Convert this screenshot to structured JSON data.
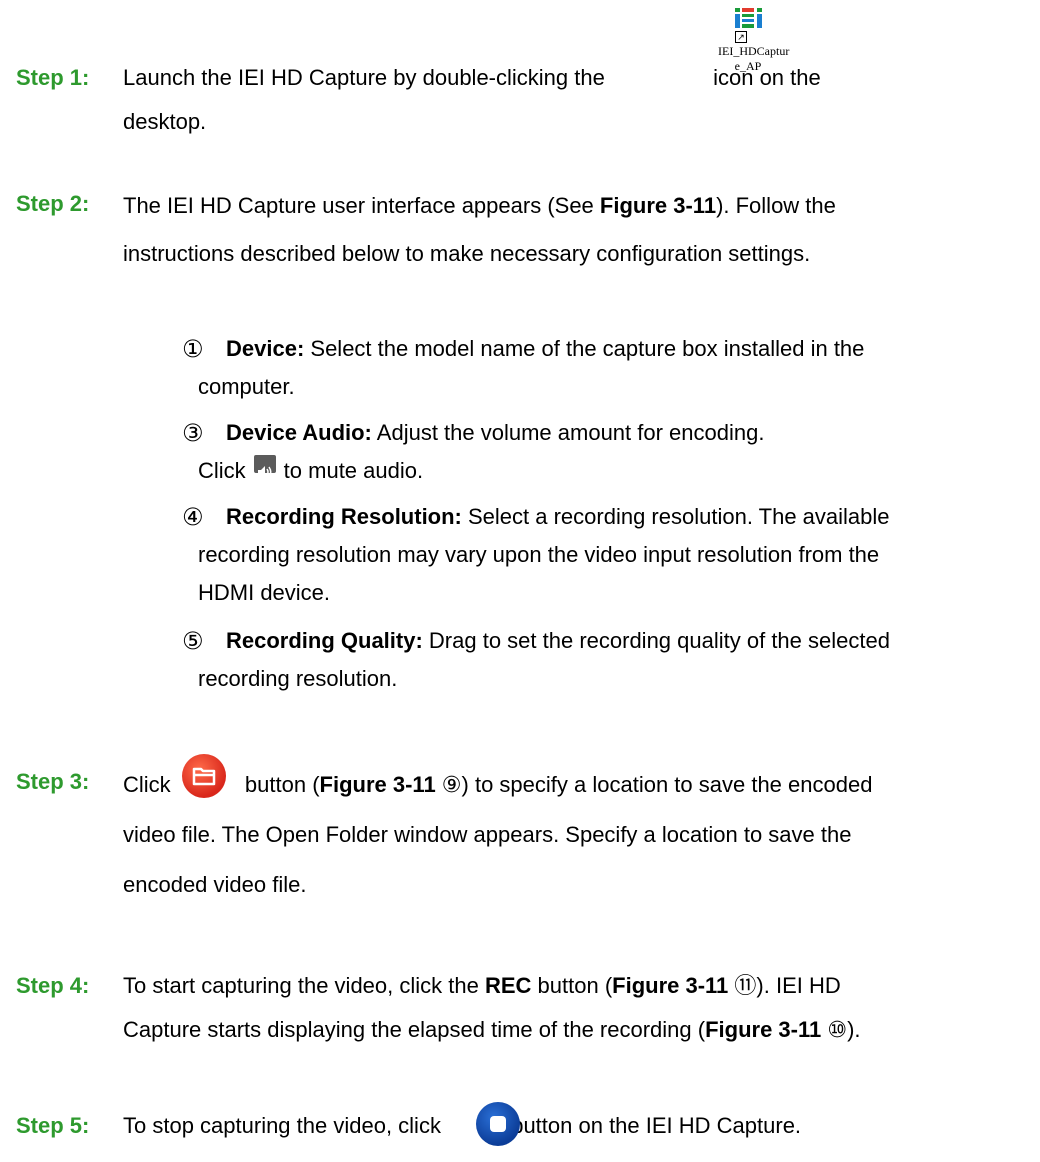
{
  "steps": [
    {
      "label": "Step 1:",
      "parts": [
        "Launch the IEI HD Capture by double-clicking the",
        "icon on the",
        "desktop."
      ],
      "icon": {
        "caption_line1": "IEI_HDCaptur",
        "caption_line2": "e_AP",
        "name": "iei-hdcapture-app-icon"
      }
    },
    {
      "label": "Step 2:",
      "line1_a": "The IEI HD Capture user interface appears (See ",
      "line1_b": "Figure 3-11",
      "line1_c": "). Follow the",
      "line2": "instructions described below to make necessary configuration settings.",
      "items": [
        {
          "num": "①",
          "label": "Device:",
          "text": " Select the model name of the capture box installed in the",
          "cont": [
            "computer."
          ]
        },
        {
          "num": "③",
          "label": "Device Audio:",
          "text": " Adjust the volume amount for encoding.",
          "cont_a": "Click",
          "cont_b": "to mute audio."
        },
        {
          "num": "④",
          "label": "Recording Resolution:",
          "text": " Select a recording resolution. The available",
          "cont": [
            "recording resolution may vary upon the video input resolution from the",
            "HDMI device."
          ]
        },
        {
          "num": "⑤",
          "label": "Recording Quality:",
          "text": " Drag to set the recording quality of the selected",
          "cont": [
            "recording resolution."
          ]
        }
      ]
    },
    {
      "label": "Step 3:",
      "a": "Click",
      "b": "button (",
      "fig": "Figure 3-11",
      "c": " ⑨) to specify a location to save the encoded",
      "line2": "video file. The Open Folder window appears. Specify a location to save the",
      "line3": "encoded video file."
    },
    {
      "label": "Step 4:",
      "a": "To start capturing the video, click the ",
      "rec": "REC",
      "b": " button (",
      "fig": "Figure 3-11",
      "c": " ⑪). IEI HD",
      "line2_a": "Capture starts displaying the elapsed time of the recording (",
      "line2_fig": "Figure 3-11",
      "line2_b": " ⑩)."
    },
    {
      "label": "Step 5:",
      "a": "To stop capturing the video, click",
      "b": "button on the IEI HD Capture."
    }
  ],
  "colors": {
    "step_label": "#2e9a2e",
    "folder_button": "#e0321f",
    "stop_button": "#0f4aa8"
  }
}
